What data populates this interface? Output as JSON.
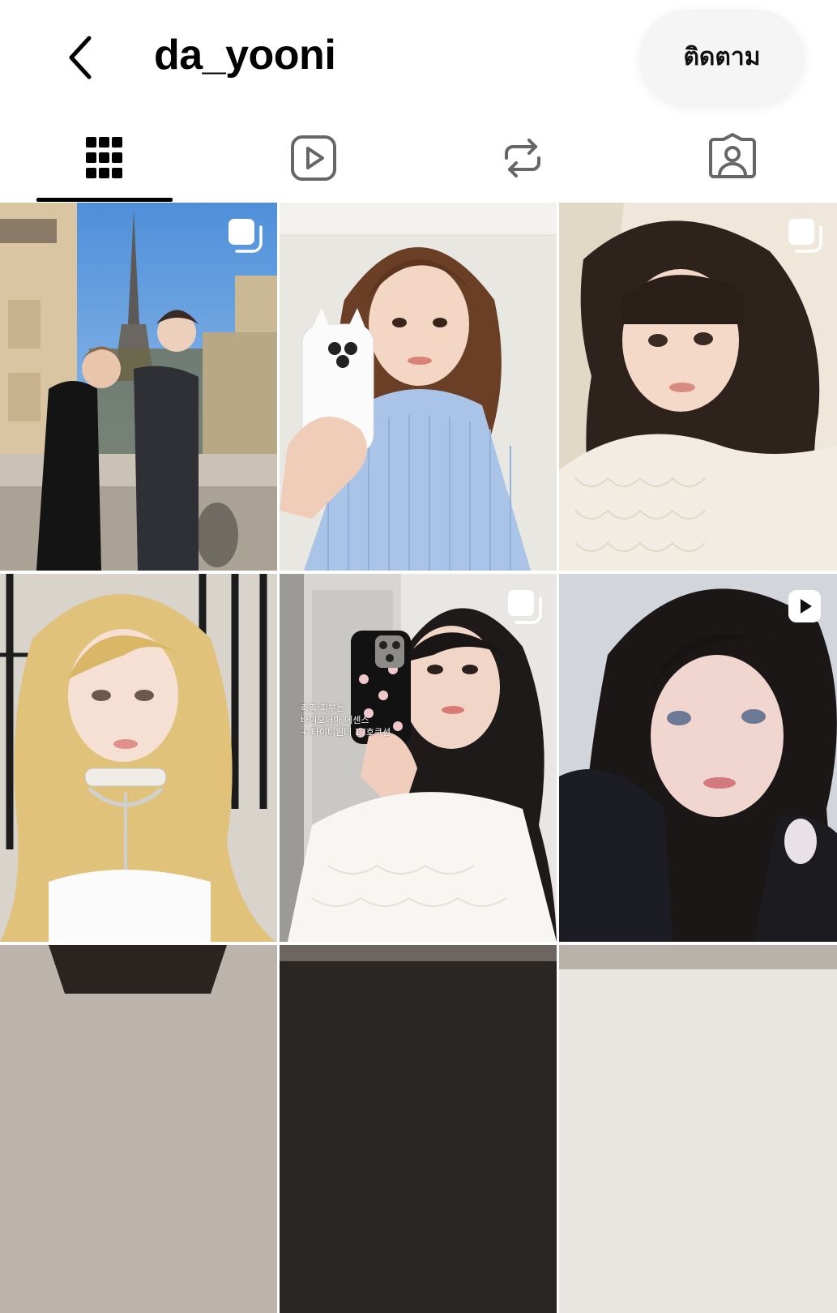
{
  "header": {
    "back_icon": "chevron-left-icon",
    "username": "da_yooni",
    "follow_label": "ติดตาม"
  },
  "tabs": [
    {
      "name": "posts",
      "icon": "grid-icon",
      "active": true
    },
    {
      "name": "reels",
      "icon": "reels-play-icon",
      "active": false
    },
    {
      "name": "reposts",
      "icon": "repost-icon",
      "active": false
    },
    {
      "name": "tagged",
      "icon": "tagged-person-icon",
      "active": false
    }
  ],
  "grid": {
    "tiles": [
      {
        "type": "carousel",
        "subject": "two men in Paris with Eiffel Tower"
      },
      {
        "type": "photo",
        "subject": "girl with bob hair holding white phone"
      },
      {
        "type": "carousel",
        "subject": "girl with long dark hair and bangs"
      },
      {
        "type": "photo",
        "subject": "blonde girl with pearl choker"
      },
      {
        "type": "carousel",
        "subject": "girl mirror selfie with floral phone case",
        "overlay_text": "촉촉 피부는\n바이오더마 에센스\n+ 타이니원더 17호쿠션"
      },
      {
        "type": "reel",
        "subject": "girl with dark hair close-up"
      }
    ]
  },
  "colors": {
    "background": "#ffffff",
    "text": "#000000",
    "follow_button_bg": "#f5f5f5",
    "tab_icon": "#666666",
    "active_tab": "#000000"
  }
}
